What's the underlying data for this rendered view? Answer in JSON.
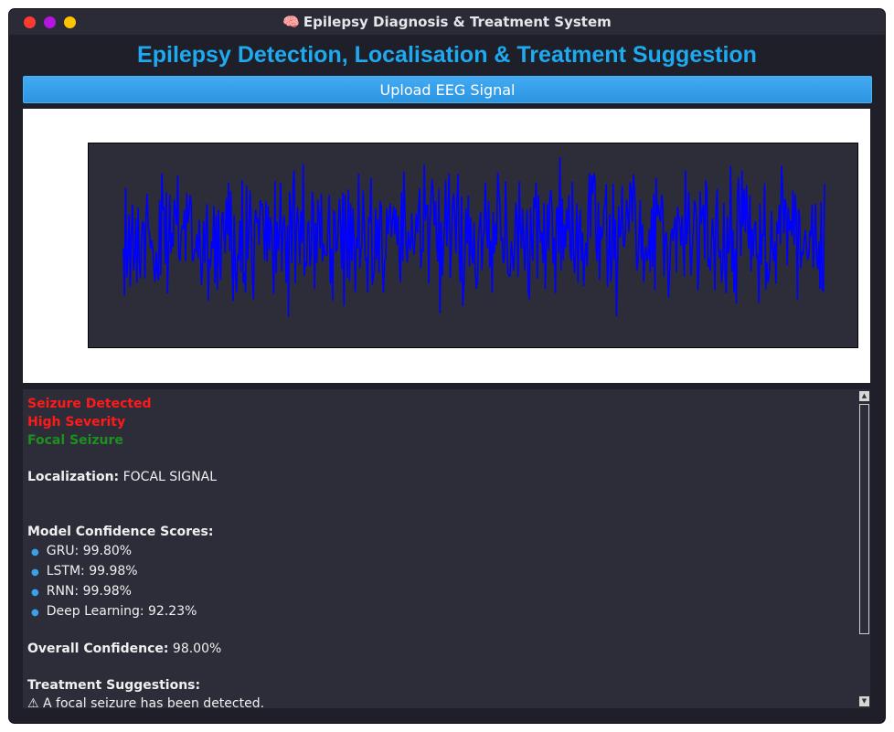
{
  "window": {
    "title": "Epilepsy Diagnosis & Treatment System",
    "title_icon": "brain-emoji",
    "traffic_lights": [
      "#ff3b30",
      "#b515e0",
      "#ffc400"
    ]
  },
  "app": {
    "heading": "Epilepsy Detection, Localisation & Treatment Suggestion",
    "upload_button": "Upload EEG Signal"
  },
  "plot": {
    "line_color": "#0000ff",
    "background": "#2d2d39"
  },
  "results": {
    "status": "Seizure Detected",
    "severity": "High Severity",
    "seizure_type": "Focal Seizure",
    "localization_label": "Localization:",
    "localization_value": "FOCAL SIGNAL",
    "scores_heading": "Model Confidence Scores:",
    "scores": [
      {
        "text": "GRU: 99.80%"
      },
      {
        "text": "LSTM: 99.98%"
      },
      {
        "text": "RNN: 99.98%"
      },
      {
        "text": "Deep Learning: 92.23%"
      }
    ],
    "overall_label": "Overall Confidence:",
    "overall_value": "98.00%",
    "treatment_heading": "Treatment Suggestions:",
    "treatment_line": "⚠ A focal seizure has been detected."
  }
}
